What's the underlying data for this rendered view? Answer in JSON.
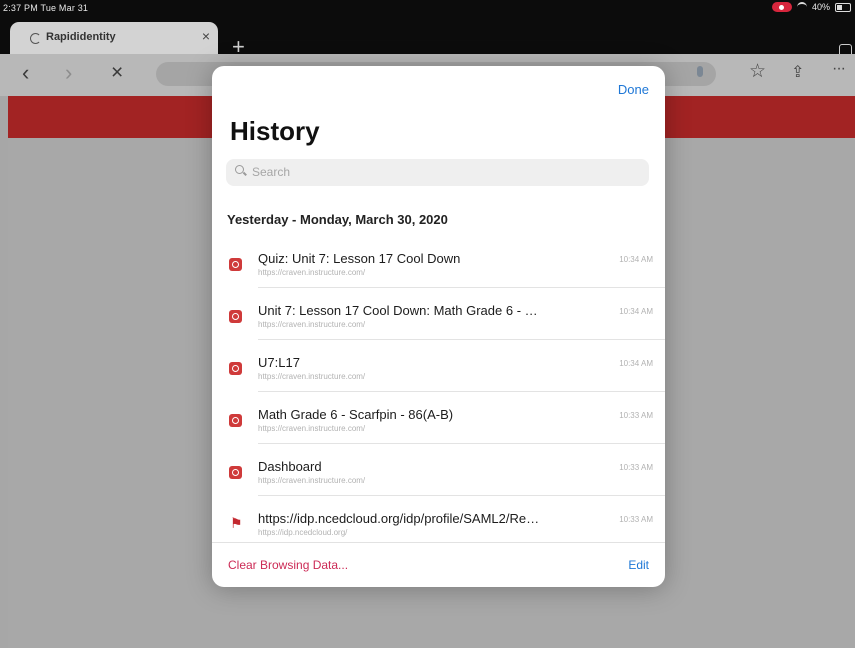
{
  "status_bar": {
    "time": "2:37 PM  Tue Mar 31",
    "battery": "40%"
  },
  "tab": {
    "title": "Rapididentity",
    "close": "×"
  },
  "toolbar": {
    "new_tab": "+",
    "back": "‹",
    "forward": "›",
    "stop": "×",
    "star": "☆",
    "share": "⇪",
    "more": "···"
  },
  "history": {
    "done_label": "Done",
    "title": "History",
    "search_placeholder": "Search",
    "section_header": "Yesterday - Monday, March 30, 2020",
    "items": [
      {
        "title": "Quiz: Unit 7: Lesson 17 Cool Down",
        "url": "https://craven.instructure.com/",
        "time": "10:34 AM",
        "icon": "canvas-icon"
      },
      {
        "title": "Unit 7: Lesson 17 Cool Down: Math Grade 6 - Scar...",
        "url": "https://craven.instructure.com/",
        "time": "10:34 AM",
        "icon": "canvas-icon"
      },
      {
        "title": "U7:L17",
        "url": "https://craven.instructure.com/",
        "time": "10:34 AM",
        "icon": "canvas-icon"
      },
      {
        "title": "Math Grade 6 - Scarfpin - 86(A-B)",
        "url": "https://craven.instructure.com/",
        "time": "10:33 AM",
        "icon": "canvas-icon"
      },
      {
        "title": "Dashboard",
        "url": "https://craven.instructure.com/",
        "time": "10:33 AM",
        "icon": "canvas-icon"
      },
      {
        "title": "https://idp.ncedcloud.org/idp/profile/SAML2/Redir...",
        "url": "https://idp.ncedcloud.org/",
        "time": "10:33 AM",
        "icon": "ncedcloud-icon"
      }
    ],
    "clear_label": "Clear Browsing Data...",
    "edit_label": "Edit"
  },
  "colors": {
    "accent_blue": "#1e77d6",
    "destructive_red": "#cc2a55",
    "page_banner_red": "#a22323"
  }
}
